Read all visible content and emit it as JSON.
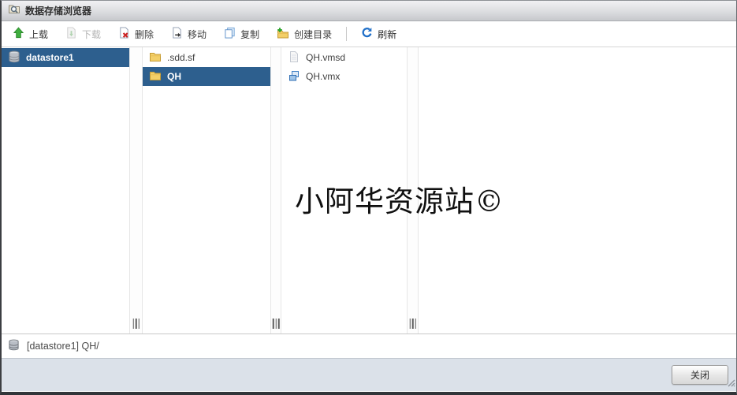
{
  "window": {
    "title": "数据存储浏览器"
  },
  "toolbar": {
    "items": [
      {
        "label": "上载",
        "icon": "upload-icon",
        "enabled": true
      },
      {
        "label": "下载",
        "icon": "download-icon",
        "enabled": false
      },
      {
        "label": "删除",
        "icon": "delete-icon",
        "enabled": true
      },
      {
        "label": "移动",
        "icon": "move-icon",
        "enabled": true
      },
      {
        "label": "复制",
        "icon": "copy-icon",
        "enabled": true
      },
      {
        "label": "创建目录",
        "icon": "create-directory-icon",
        "enabled": true
      },
      {
        "label": "刷新",
        "icon": "refresh-icon",
        "enabled": true
      }
    ]
  },
  "browser": {
    "columns": [
      {
        "items": [
          {
            "label": "datastore1",
            "icon": "datastore-icon",
            "selected": true
          }
        ]
      },
      {
        "items": [
          {
            "label": ".sdd.sf",
            "icon": "folder-icon",
            "selected": false
          },
          {
            "label": "QH",
            "icon": "folder-icon",
            "selected": true
          }
        ]
      },
      {
        "items": [
          {
            "label": "QH.vmsd",
            "icon": "file-icon",
            "selected": false
          },
          {
            "label": "QH.vmx",
            "icon": "vm-file-icon",
            "selected": false
          }
        ]
      }
    ]
  },
  "watermark": {
    "text": "小阿华资源站©"
  },
  "statusbar": {
    "path": "[datastore1] QH/",
    "icon": "datastore-icon"
  },
  "footer": {
    "close_label": "关闭"
  },
  "colors": {
    "selection_blue": "#2d5f8e",
    "accent_blue": "#1e6ec8",
    "folder_yellow": "#f3cf68",
    "delete_red": "#cc2222",
    "upload_green": "#3fae3f",
    "footer_gray": "#dbe1e9"
  }
}
